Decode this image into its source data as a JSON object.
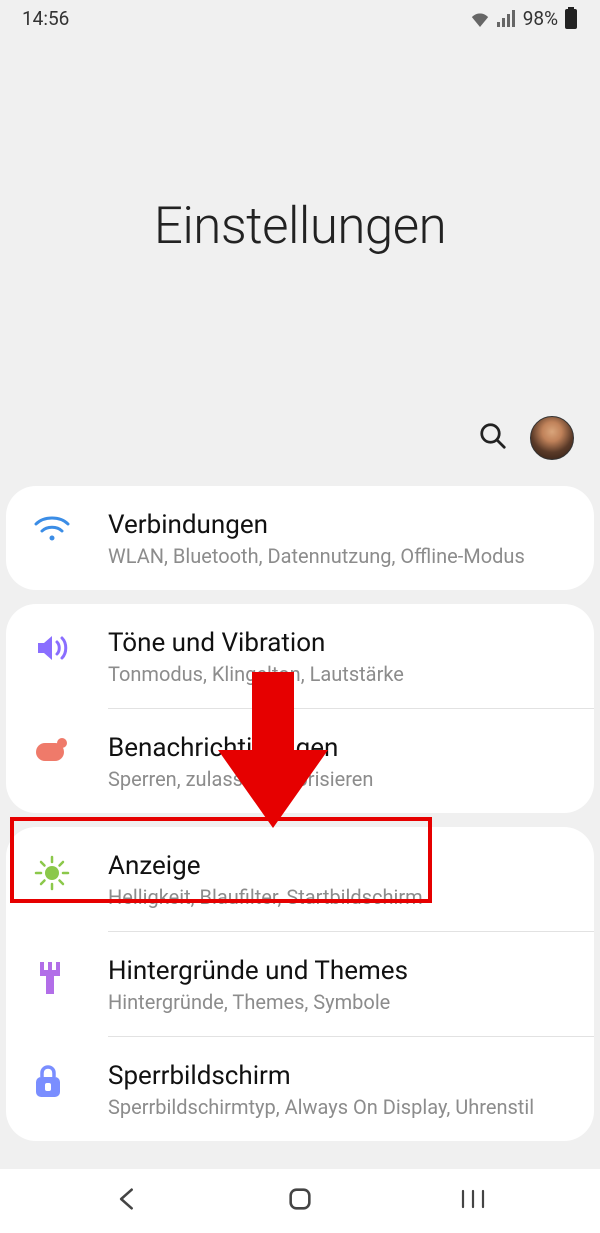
{
  "status": {
    "time": "14:56",
    "battery_pct": "98%"
  },
  "header": {
    "title": "Einstellungen"
  },
  "cards": [
    {
      "rows": [
        {
          "icon": "wifi",
          "title": "Verbindungen",
          "sub": "WLAN, Bluetooth, Datennutzung, Offline-Modus"
        }
      ]
    },
    {
      "rows": [
        {
          "icon": "sound",
          "title": "Töne und Vibration",
          "sub": "Tonmodus, Klingelton, Lautstärke"
        },
        {
          "icon": "notify",
          "title": "Benachrichtigungen",
          "sub": "Sperren, zulassen, priorisieren"
        }
      ]
    },
    {
      "rows": [
        {
          "icon": "display",
          "title": "Anzeige",
          "sub": "Helligkeit, Blaufilter, Startbildschirm"
        },
        {
          "icon": "themes",
          "title": "Hintergründe und Themes",
          "sub": "Hintergründe, Themes, Symbole"
        },
        {
          "icon": "lock",
          "title": "Sperrbildschirm",
          "sub": "Sperrbildschirmtyp, Always On Display, Uhrenstil"
        }
      ]
    }
  ],
  "highlight": {
    "target": "Anzeige"
  }
}
